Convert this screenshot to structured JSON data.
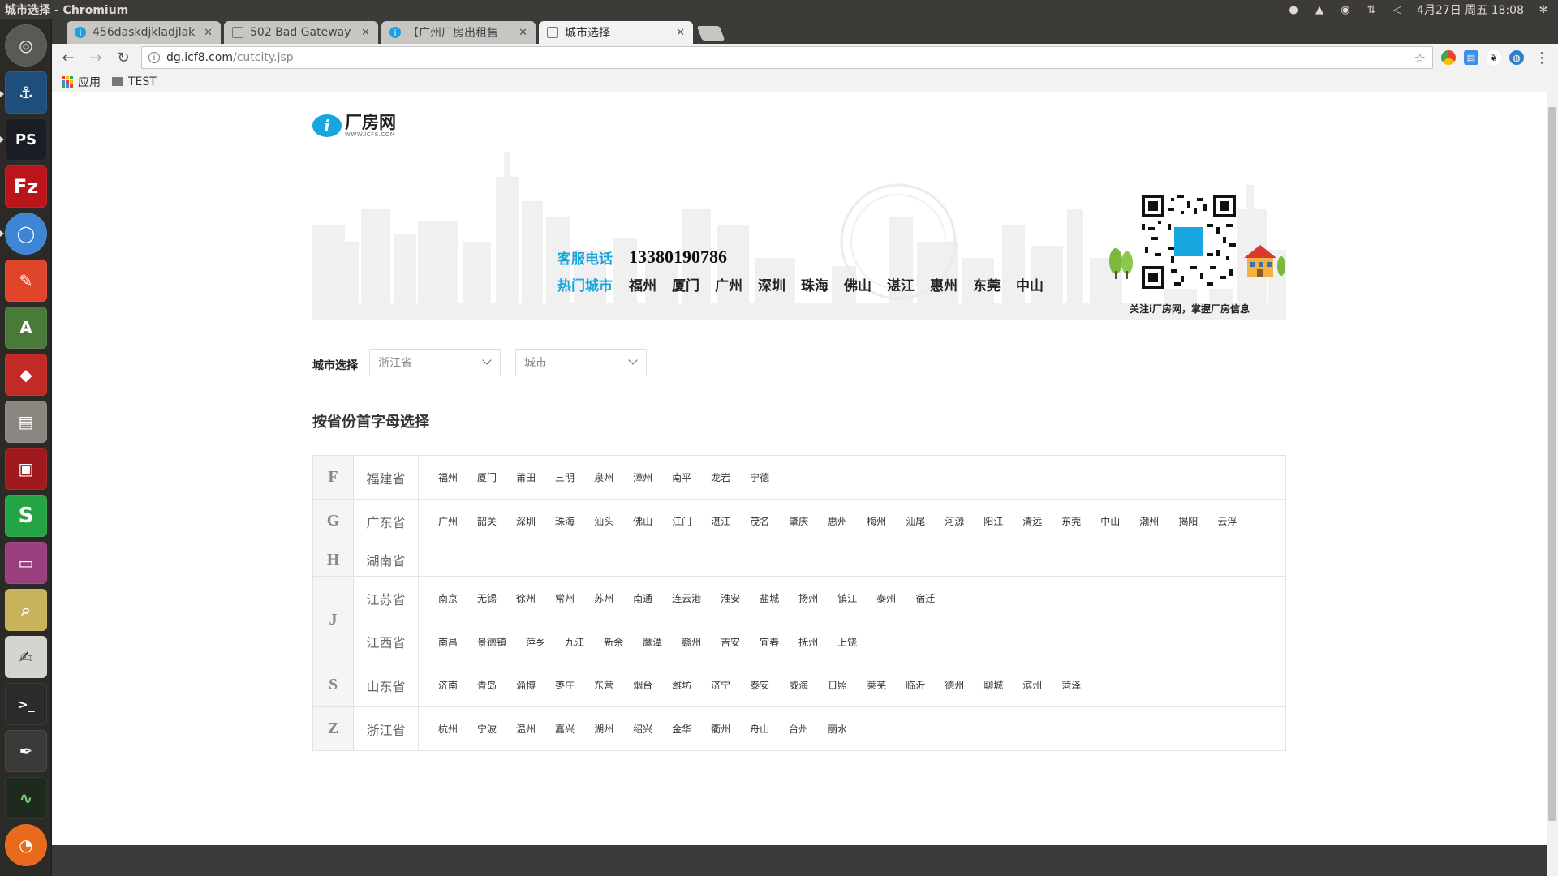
{
  "system": {
    "window_title": "城市选择 - Chromium",
    "clock": "4月27日 周五 18:08"
  },
  "browser": {
    "tabs": [
      {
        "label": "456daskdjkladjlak",
        "favicon": "blue-circle-icon"
      },
      {
        "label": "502 Bad Gateway",
        "favicon": "document-icon"
      },
      {
        "label": "【广州厂房出租售",
        "favicon": "blue-circle-icon"
      },
      {
        "label": "城市选择",
        "favicon": "document-icon"
      }
    ],
    "url_host": "dg.icf8.com",
    "url_path": "/cutcity.jsp",
    "bookmarks": {
      "apps": "应用",
      "folder": "TEST"
    }
  },
  "site": {
    "logo_cn": "厂房网",
    "logo_en": "WWW.ICF8.COM",
    "logo_mark": "i",
    "hotline_label": "客服电话",
    "hotline_number": "13380190786",
    "hot_cities_label": "热门城市",
    "hot_cities": [
      "福州",
      "厦门",
      "广州",
      "深圳",
      "珠海",
      "佛山",
      "湛江",
      "惠州",
      "东莞",
      "中山"
    ],
    "qr_caption": "关注i厂房网，掌握厂房信息",
    "selector_label": "城市选择",
    "province_select": "浙江省",
    "city_select": "城市",
    "section_title": "按省份首字母选择"
  },
  "groups": [
    {
      "letter": "F",
      "provinces": [
        {
          "name": "福建省",
          "cities": [
            "福州",
            "厦门",
            "莆田",
            "三明",
            "泉州",
            "漳州",
            "南平",
            "龙岩",
            "宁德"
          ]
        }
      ]
    },
    {
      "letter": "G",
      "provinces": [
        {
          "name": "广东省",
          "cities": [
            "广州",
            "韶关",
            "深圳",
            "珠海",
            "汕头",
            "佛山",
            "江门",
            "湛江",
            "茂名",
            "肇庆",
            "惠州",
            "梅州",
            "汕尾",
            "河源",
            "阳江",
            "清远",
            "东莞",
            "中山",
            "潮州",
            "揭阳",
            "云浮"
          ]
        }
      ]
    },
    {
      "letter": "H",
      "provinces": [
        {
          "name": "湖南省",
          "cities": []
        }
      ]
    },
    {
      "letter": "J",
      "provinces": [
        {
          "name": "江苏省",
          "cities": [
            "南京",
            "无锡",
            "徐州",
            "常州",
            "苏州",
            "南通",
            "连云港",
            "淮安",
            "盐城",
            "扬州",
            "镇江",
            "泰州",
            "宿迁"
          ]
        },
        {
          "name": "江西省",
          "cities": [
            "南昌",
            "景德镇",
            "萍乡",
            "九江",
            "新余",
            "鹰潭",
            "赣州",
            "吉安",
            "宜春",
            "抚州",
            "上饶"
          ]
        }
      ]
    },
    {
      "letter": "S",
      "provinces": [
        {
          "name": "山东省",
          "cities": [
            "济南",
            "青岛",
            "淄博",
            "枣庄",
            "东营",
            "烟台",
            "潍坊",
            "济宁",
            "泰安",
            "威海",
            "日照",
            "莱芜",
            "临沂",
            "德州",
            "聊城",
            "滨州",
            "菏泽"
          ]
        }
      ]
    },
    {
      "letter": "Z",
      "provinces": [
        {
          "name": "浙江省",
          "cities": [
            "杭州",
            "宁波",
            "温州",
            "嘉兴",
            "湖州",
            "绍兴",
            "金华",
            "衢州",
            "舟山",
            "台州",
            "丽水"
          ]
        }
      ]
    }
  ],
  "colors": {
    "accent": "#17a6e0",
    "panel": "#3c3b37"
  }
}
